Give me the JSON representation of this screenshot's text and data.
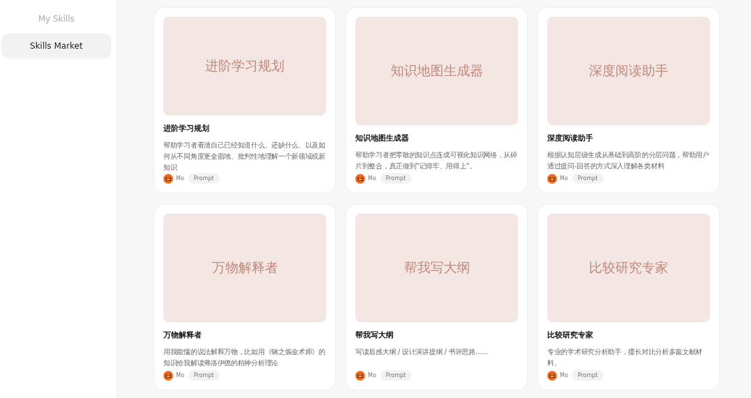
{
  "sidebar": {
    "items": [
      {
        "label": "My Skills",
        "selected": false
      },
      {
        "label": "Skills Market",
        "selected": true
      }
    ]
  },
  "cards": [
    {
      "cover": "进阶学习规划",
      "title": "进阶学习规划",
      "description": "帮助学习者看清自己已经知道什么、还缺什么、以及如何从不同角度更全面地、批判性地理解一个新领域或新知识",
      "author": "Mo",
      "tag": "Prompt"
    },
    {
      "cover": "知识地图生成器",
      "title": "知识地图生成器",
      "description": "帮助学习者把零散的知识点连成可视化知识网络，从碎片到整合，真正做到\"记得牢、用得上\"。",
      "author": "Mo",
      "tag": "Prompt"
    },
    {
      "cover": "深度阅读助手",
      "title": "深度阅读助手",
      "description": "根据认知层级生成从基础到高阶的分层问题，帮助用户通过提问-回答的方式深入理解各类材料",
      "author": "Mo",
      "tag": "Prompt"
    },
    {
      "cover": "万物解释者",
      "title": "万物解释者",
      "description": "用我能懂的说法解释万物，比如用《钢之炼金术师》的知识给我解读弗洛伊德的精神分析理论",
      "author": "Mo",
      "tag": "Prompt"
    },
    {
      "cover": "帮我写大纲",
      "title": "帮我写大纲",
      "description": "写读后感大纲 / 设计演讲提纲 / 书评思路......",
      "author": "Mo",
      "tag": "Prompt"
    },
    {
      "cover": "比较研究专家",
      "title": "比较研究专家",
      "description": "专业的学术研究分析助手，擅长对比分析多篇文献材料。",
      "author": "Mo",
      "tag": "Prompt"
    }
  ]
}
